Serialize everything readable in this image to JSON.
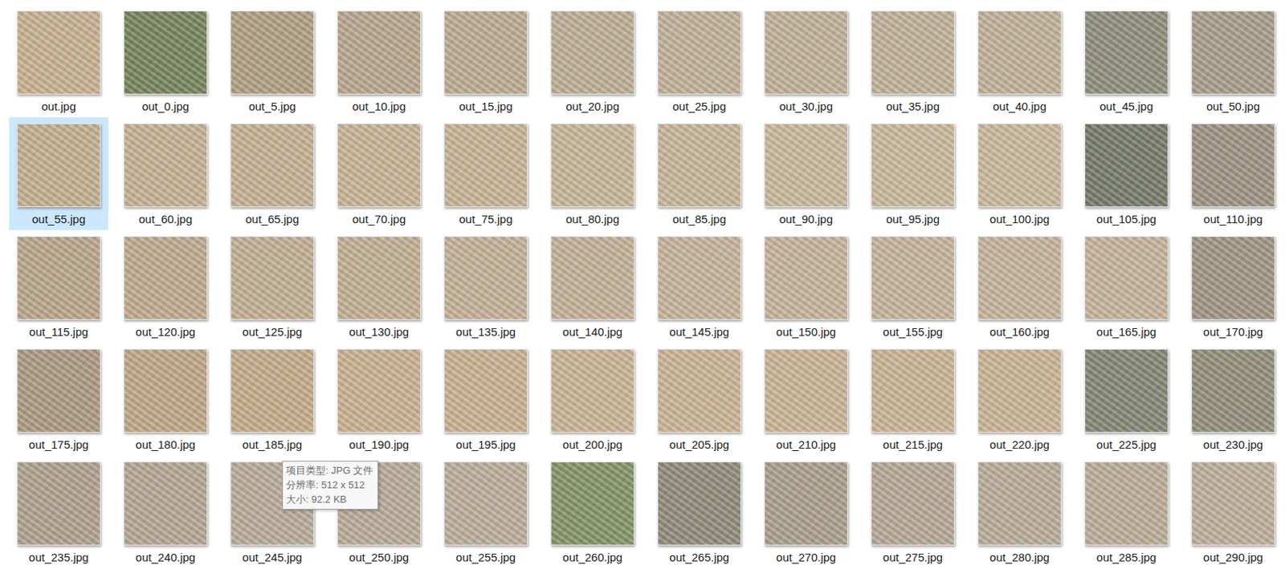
{
  "items": [
    {
      "name": "out.jpg",
      "selected": false,
      "color": "#c8b08e"
    },
    {
      "name": "out_0.jpg",
      "selected": false,
      "color": "#6f7f55"
    },
    {
      "name": "out_5.jpg",
      "selected": false,
      "color": "#b09c80"
    },
    {
      "name": "out_10.jpg",
      "selected": false,
      "color": "#b7a58b"
    },
    {
      "name": "out_15.jpg",
      "selected": false,
      "color": "#bbaa90"
    },
    {
      "name": "out_20.jpg",
      "selected": false,
      "color": "#bdad94"
    },
    {
      "name": "out_25.jpg",
      "selected": false,
      "color": "#c0b098"
    },
    {
      "name": "out_30.jpg",
      "selected": false,
      "color": "#c0b098"
    },
    {
      "name": "out_35.jpg",
      "selected": false,
      "color": "#c0b098"
    },
    {
      "name": "out_40.jpg",
      "selected": false,
      "color": "#c0b098"
    },
    {
      "name": "out_45.jpg",
      "selected": false,
      "color": "#8a8a78"
    },
    {
      "name": "out_50.jpg",
      "selected": false,
      "color": "#a59a88"
    },
    {
      "name": "out_55.jpg",
      "selected": true,
      "color": "#c4ae8e"
    },
    {
      "name": "out_60.jpg",
      "selected": false,
      "color": "#c6b092"
    },
    {
      "name": "out_65.jpg",
      "selected": false,
      "color": "#c6b092"
    },
    {
      "name": "out_70.jpg",
      "selected": false,
      "color": "#c8b394"
    },
    {
      "name": "out_75.jpg",
      "selected": false,
      "color": "#c8b394"
    },
    {
      "name": "out_80.jpg",
      "selected": false,
      "color": "#c8b598"
    },
    {
      "name": "out_85.jpg",
      "selected": false,
      "color": "#c8b598"
    },
    {
      "name": "out_90.jpg",
      "selected": false,
      "color": "#cab89c"
    },
    {
      "name": "out_95.jpg",
      "selected": false,
      "color": "#cab89c"
    },
    {
      "name": "out_100.jpg",
      "selected": false,
      "color": "#cab89c"
    },
    {
      "name": "out_105.jpg",
      "selected": false,
      "color": "#6e7466"
    },
    {
      "name": "out_110.jpg",
      "selected": false,
      "color": "#9a8f80"
    },
    {
      "name": "out_115.jpg",
      "selected": false,
      "color": "#b8a488"
    },
    {
      "name": "out_120.jpg",
      "selected": false,
      "color": "#bea98c"
    },
    {
      "name": "out_125.jpg",
      "selected": false,
      "color": "#c2ae92"
    },
    {
      "name": "out_130.jpg",
      "selected": false,
      "color": "#c2ae92"
    },
    {
      "name": "out_135.jpg",
      "selected": false,
      "color": "#c4b096"
    },
    {
      "name": "out_140.jpg",
      "selected": false,
      "color": "#c4b096"
    },
    {
      "name": "out_145.jpg",
      "selected": false,
      "color": "#c6b39a"
    },
    {
      "name": "out_150.jpg",
      "selected": false,
      "color": "#c6b39a"
    },
    {
      "name": "out_155.jpg",
      "selected": false,
      "color": "#c6b39a"
    },
    {
      "name": "out_160.jpg",
      "selected": false,
      "color": "#c6b39a"
    },
    {
      "name": "out_165.jpg",
      "selected": false,
      "color": "#c6b39a"
    },
    {
      "name": "out_170.jpg",
      "selected": false,
      "color": "#9c9280"
    },
    {
      "name": "out_175.jpg",
      "selected": false,
      "color": "#a8977e"
    },
    {
      "name": "out_180.jpg",
      "selected": false,
      "color": "#bea584"
    },
    {
      "name": "out_185.jpg",
      "selected": false,
      "color": "#c4aa88"
    },
    {
      "name": "out_190.jpg",
      "selected": false,
      "color": "#c9b08f"
    },
    {
      "name": "out_195.jpg",
      "selected": false,
      "color": "#c9b08f"
    },
    {
      "name": "out_200.jpg",
      "selected": false,
      "color": "#cbb394"
    },
    {
      "name": "out_205.jpg",
      "selected": false,
      "color": "#cbb394"
    },
    {
      "name": "out_210.jpg",
      "selected": false,
      "color": "#cbb394"
    },
    {
      "name": "out_215.jpg",
      "selected": false,
      "color": "#cbb394"
    },
    {
      "name": "out_220.jpg",
      "selected": false,
      "color": "#cbb394"
    },
    {
      "name": "out_225.jpg",
      "selected": false,
      "color": "#7e8270"
    },
    {
      "name": "out_230.jpg",
      "selected": false,
      "color": "#8e8a78"
    },
    {
      "name": "out_235.jpg",
      "selected": false,
      "color": "#ad9f8c"
    },
    {
      "name": "out_240.jpg",
      "selected": false,
      "color": "#b3a592"
    },
    {
      "name": "out_245.jpg",
      "selected": false,
      "color": "#b7aa98"
    },
    {
      "name": "out_250.jpg",
      "selected": false,
      "color": "#b7aa98"
    },
    {
      "name": "out_255.jpg",
      "selected": false,
      "color": "#baad9a"
    },
    {
      "name": "out_260.jpg",
      "selected": false,
      "color": "#7d9060"
    },
    {
      "name": "out_265.jpg",
      "selected": false,
      "color": "#8c8676"
    },
    {
      "name": "out_270.jpg",
      "selected": false,
      "color": "#a89c8a"
    },
    {
      "name": "out_275.jpg",
      "selected": false,
      "color": "#b4a794"
    },
    {
      "name": "out_280.jpg",
      "selected": false,
      "color": "#b8ab98"
    },
    {
      "name": "out_285.jpg",
      "selected": false,
      "color": "#bbac98"
    },
    {
      "name": "out_290.jpg",
      "selected": false,
      "color": "#bdae9a"
    }
  ],
  "tooltip": {
    "lines": [
      "项目类型: JPG 文件",
      "分辨率: 512 x 512",
      "大小: 92.2 KB"
    ]
  }
}
